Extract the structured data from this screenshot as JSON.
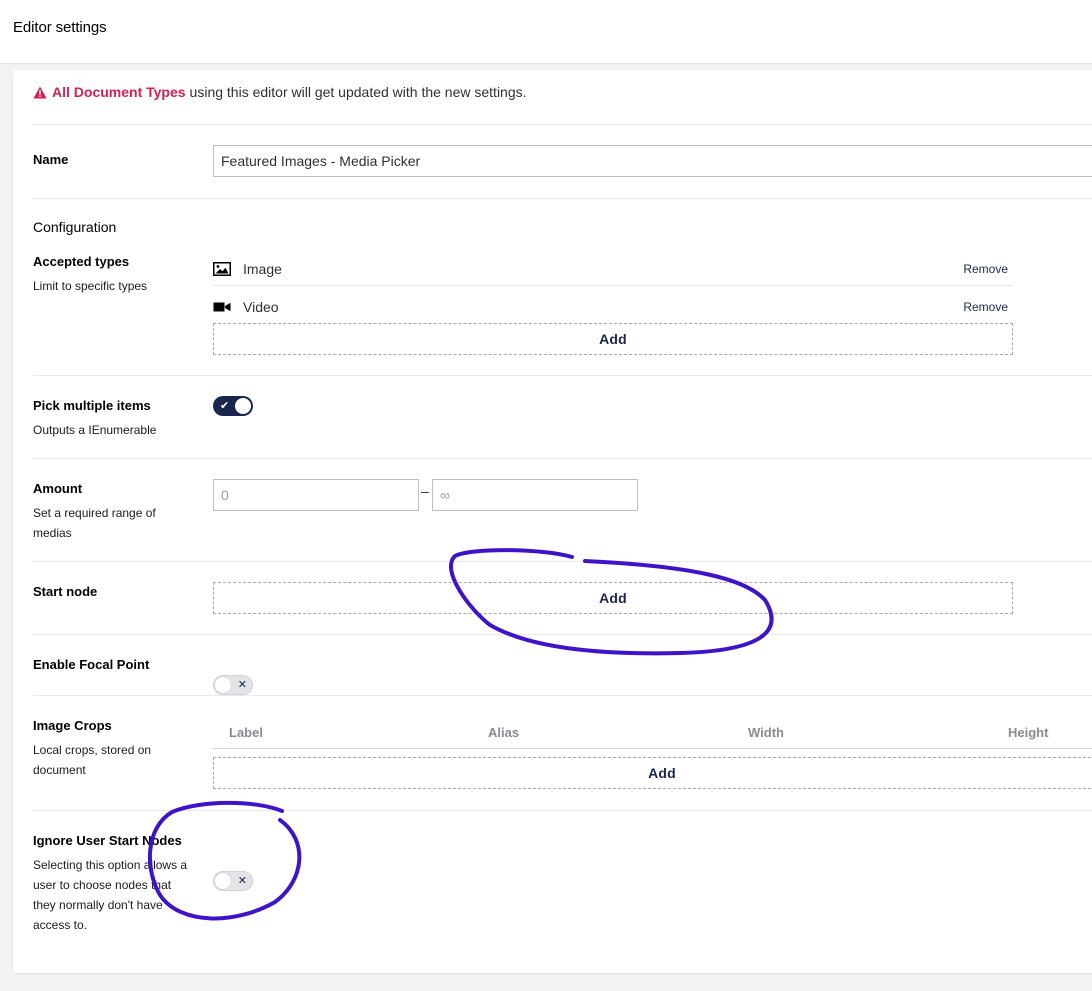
{
  "header": {
    "title": "Editor settings"
  },
  "warning": {
    "highlight": "All Document Types",
    "text": "using this editor will get updated with the new settings.",
    "icon": "warning-triangle-icon",
    "color": "#d42054"
  },
  "name_field": {
    "label": "Name",
    "value": "Featured Images - Media Picker"
  },
  "configuration": {
    "title": "Configuration"
  },
  "accepted_types": {
    "label": "Accepted types",
    "description": "Limit to specific types",
    "items": [
      {
        "name": "Image",
        "icon": "image-icon",
        "remove_label": "Remove"
      },
      {
        "name": "Video",
        "icon": "video-camera-icon",
        "remove_label": "Remove"
      }
    ],
    "add_label": "Add"
  },
  "pick_multiple": {
    "label": "Pick multiple items",
    "description": "Outputs a IEnumerable",
    "enabled": true,
    "on_mark": "✔"
  },
  "amount": {
    "label": "Amount",
    "description": "Set a required range of medias",
    "min_placeholder": "0",
    "separator": "–",
    "max_placeholder": "∞"
  },
  "start_node": {
    "label": "Start node",
    "add_label": "Add"
  },
  "focal_point": {
    "label": "Enable Focal Point",
    "enabled": false,
    "off_mark": "✕"
  },
  "image_crops": {
    "label": "Image Crops",
    "description": "Local crops, stored on document",
    "columns": [
      "Label",
      "Alias",
      "Width",
      "Height"
    ],
    "add_label": "Add"
  },
  "ignore_start_nodes": {
    "label": "Ignore User Start Nodes",
    "description": "Selecting this option allows a user to choose nodes that they normally don't have access to.",
    "enabled": false,
    "off_mark": "✕"
  },
  "theme": {
    "primary": "#1b264f",
    "danger": "#d42054",
    "annotation": "#3f14c8"
  }
}
